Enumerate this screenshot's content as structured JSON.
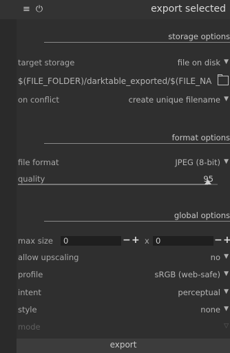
{
  "header": {
    "title": "export selected",
    "menu_icon": "≡",
    "reset_icon": "⏻"
  },
  "storage": {
    "section_title": "storage options",
    "target_label": "target storage",
    "target_value": "file on disk",
    "path_value": "$(FILE_FOLDER)/darktable_exported/$(FILE_NAME)",
    "conflict_label": "on conflict",
    "conflict_value": "create unique filename"
  },
  "format": {
    "section_title": "format options",
    "file_format_label": "file format",
    "file_format_value": "JPEG (8-bit)",
    "quality_label": "quality",
    "quality_value": "95",
    "quality_fraction": 0.95
  },
  "global": {
    "section_title": "global options",
    "max_size_label": "max size",
    "max_width": "0",
    "max_height": "0",
    "x_separator": "x",
    "upscaling_label": "allow upscaling",
    "upscaling_value": "no",
    "profile_label": "profile",
    "profile_value": "sRGB (web-safe)",
    "intent_label": "intent",
    "intent_value": "perceptual",
    "style_label": "style",
    "style_value": "none",
    "mode_label": "mode"
  },
  "export_button": "export",
  "icons": {
    "dropdown": "▼",
    "minus": "−",
    "plus": "+"
  }
}
